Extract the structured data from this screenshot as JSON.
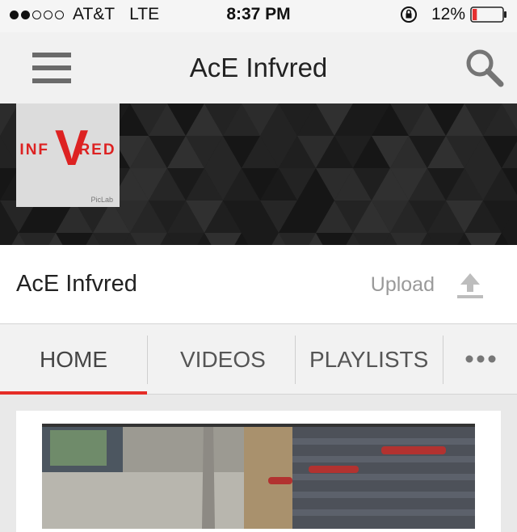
{
  "status_bar": {
    "carrier": "AT&T",
    "network": "LTE",
    "time": "8:37 PM",
    "battery": "12%",
    "signal_bars_filled": 2,
    "signal_bars_total": 5,
    "battery_level": 0.12
  },
  "navbar": {
    "title": "AcE Infvred",
    "menu_icon": "hamburger-menu-icon",
    "search_icon": "search-icon"
  },
  "channel": {
    "avatar_text_left": "INF",
    "avatar_v": "V",
    "avatar_text_right": "RED",
    "avatar_watermark": "PicLab",
    "name": "AcE Infvred",
    "upload_label": "Upload",
    "upload_icon": "upload-icon"
  },
  "tabs": [
    {
      "label": "HOME",
      "active": true
    },
    {
      "label": "VIDEOS",
      "active": false
    },
    {
      "label": "PLAYLISTS",
      "active": false
    }
  ],
  "colors": {
    "accent": "#e52d27",
    "battery_low": "#e53030"
  }
}
